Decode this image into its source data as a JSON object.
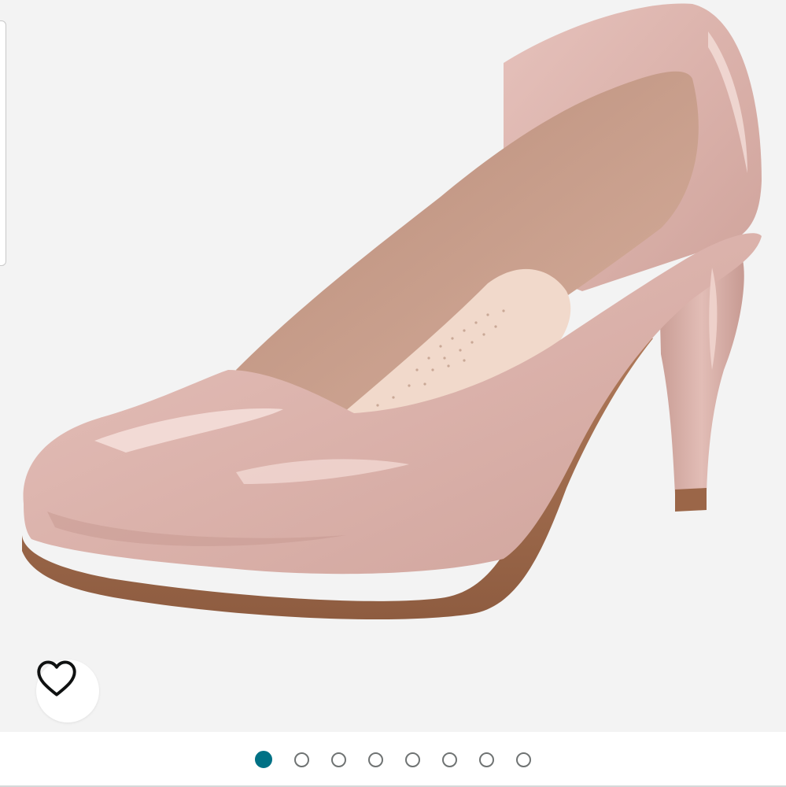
{
  "product_image": {
    "description_icon": "pink-patent-platform-pump-shoe",
    "colors": {
      "background": "#f3f3f3",
      "upper": "#dcb4ae",
      "upper_highlight": "#f4dad5",
      "upper_shadow": "#c59890",
      "lining": "#c9a08e",
      "insole": "#f2dccf",
      "sole": "#a06a4c"
    }
  },
  "wishlist": {
    "icon": "heart-outline-icon",
    "color": "#0f1111"
  },
  "carousel": {
    "total_images": 8,
    "active_index": 0,
    "active_color": "#007185",
    "inactive_color": "#6f7373"
  }
}
